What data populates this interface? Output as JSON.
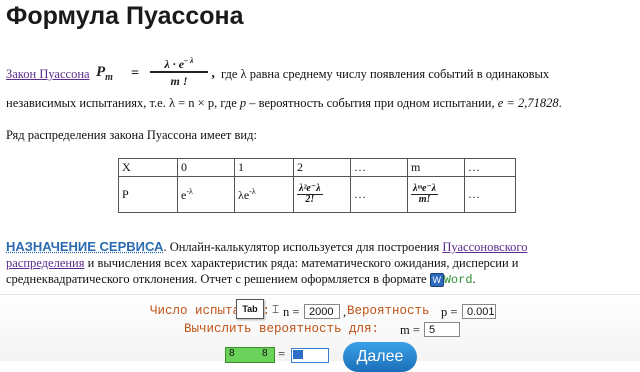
{
  "page": {
    "title": "Формула Пуассона"
  },
  "intro": {
    "link": "Закон Пуассона",
    "formula_lhs_p": "P",
    "formula_lhs_sub": "m",
    "formula_eq": "=",
    "formula_num": "λ · e",
    "formula_num_sup": "– λ",
    "formula_den": "m !",
    "formula_comma": ",",
    "text1": " где λ равна среднему числу появления событий в одинаковых",
    "text2a": "независимых испытаниях, т.е. λ = n × p, где ",
    "text2b_p": "p",
    "text2c": " – вероятность события при одном испытании, ",
    "text2d_e": "e = 2,71828",
    "text2e": "."
  },
  "distribution": {
    "caption": "Ряд распределения закона Пуассона имеет вид:",
    "row_x": [
      "X",
      "0",
      "1",
      "2",
      "…",
      "m",
      "…"
    ],
    "row_p_label": "P",
    "cell_0_base": "e",
    "cell_0_sup": "-λ",
    "cell_1_base": "λe",
    "cell_1_sup": "-λ",
    "frac_2_num": "λ²e⁻λ",
    "frac_2_den": "2!",
    "dots": "…",
    "frac_m_num": "λᵐe⁻λ",
    "frac_m_den": "m!",
    "dots2": "…"
  },
  "service": {
    "heading": "НАЗНАЧЕНИЕ СЕРВИСА",
    "text1": ". Онлайн-калькулятор используется для построения ",
    "link1": "Пуассоновского",
    "link2": "распределения",
    "text2": " и вычисления всех характеристик ряда: математического ожидания, дисперсии и",
    "text3": "среднеквадратического отклонения. Отчет с решением оформляется в формате ",
    "word_icon": "W",
    "word_label": "Word",
    "text4": "."
  },
  "form": {
    "count_label": "Число испытаний:",
    "n_label": "n =",
    "n_value": "2000",
    "comma": ",",
    "prob_label": "Вероятность",
    "p_label": "p =",
    "p_value": "0.001",
    "calc_label": "Вычислить вероятность для:",
    "m_label": "m =",
    "m_value": "5",
    "green_left": "8",
    "green_right": "8",
    "eq": "=",
    "next_button": "Далее"
  },
  "tooltip": {
    "tab": "Tab"
  }
}
